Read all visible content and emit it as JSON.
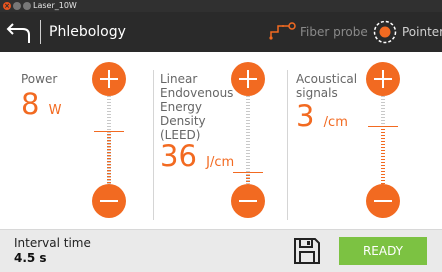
{
  "window": {
    "title": "Laser_10W"
  },
  "header": {
    "title": "Phlebology",
    "fiber_probe_label": "Fiber probe",
    "pointer_label": "Pointer"
  },
  "params": [
    {
      "name": "power",
      "label": "Power",
      "value": "8",
      "unit": "W",
      "level": 0.6
    },
    {
      "name": "leed",
      "label": "Linear Endovenous Energy Density (LEED)",
      "value": "36",
      "unit": "J/cm",
      "level": 0.14
    },
    {
      "name": "acoustical",
      "label": "Acoustical signals",
      "value": "3",
      "unit": "/cm",
      "level": 0.66
    }
  ],
  "footer": {
    "interval_label": "Interval time",
    "interval_value": "4.5 s",
    "ready_label": "READY"
  },
  "colors": {
    "accent": "#f26a21",
    "ready": "#7cc242",
    "header_bg": "#2a2a2a"
  }
}
